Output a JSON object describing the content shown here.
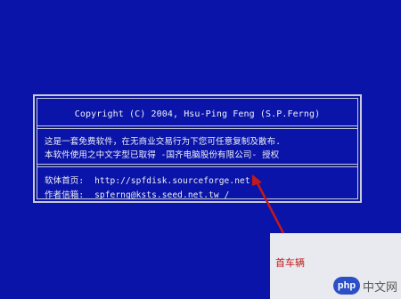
{
  "dialog": {
    "copyright": "Copyright (C) 2004, Hsu-Ping Feng (S.P.Ferng)",
    "description_line1": "这是一套免费软件，在无商业交易行为下您可任意复制及散布.",
    "description_line2": "本软件使用之中文字型已取得 -国齐电脑股份有限公司- 授权",
    "homepage_label": "软体首页:",
    "homepage_url": "http://spfdisk.sourceforge.net",
    "email_label": "作者信箱:",
    "email_value": "spferng@ksts.seed.net.tw",
    "cursor": "/"
  },
  "annotation": {
    "text": "首车辆"
  },
  "watermark": {
    "logo": "php",
    "text": "中文网"
  },
  "colors": {
    "background": "#0a14a8",
    "foreground": "#eef0f5",
    "border": "#c9ccd6",
    "annotation": "#c21a1a"
  }
}
